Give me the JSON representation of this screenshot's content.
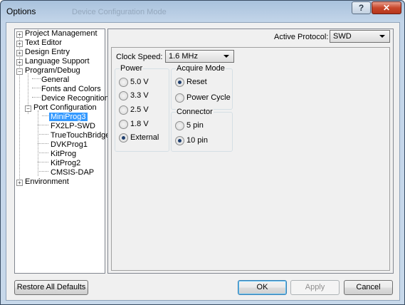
{
  "window": {
    "title": "Options",
    "ghost_title": "Device Configuration Mode"
  },
  "tree": {
    "items": [
      {
        "label": "Project Management"
      },
      {
        "label": "Text Editor"
      },
      {
        "label": "Design Entry"
      },
      {
        "label": "Language Support"
      },
      {
        "label": "Program/Debug"
      },
      {
        "label": "General"
      },
      {
        "label": "Fonts and Colors"
      },
      {
        "label": "Device Recognition"
      },
      {
        "label": "Port Configuration"
      },
      {
        "label": "MiniProg3"
      },
      {
        "label": "FX2LP-SWD"
      },
      {
        "label": "TrueTouchBridge"
      },
      {
        "label": "DVKProg1"
      },
      {
        "label": "KitProg"
      },
      {
        "label": "KitProg2"
      },
      {
        "label": "CMSIS-DAP"
      },
      {
        "label": "Environment"
      }
    ],
    "selected": "MiniProg3"
  },
  "panel": {
    "protocol_label": "Active Protocol:",
    "protocol_value": "SWD",
    "clock_label": "Clock Speed:",
    "clock_value": "1.6 MHz",
    "power": {
      "title": "Power",
      "options": [
        "5.0 V",
        "3.3 V",
        "2.5 V",
        "1.8 V",
        "External"
      ],
      "selected": "External"
    },
    "acquire": {
      "title": "Acquire Mode",
      "options": [
        "Reset",
        "Power Cycle"
      ],
      "selected": "Reset"
    },
    "connector": {
      "title": "Connector",
      "options": [
        "5 pin",
        "10 pin"
      ],
      "selected": "10 pin"
    }
  },
  "buttons": {
    "restore": "Restore All Defaults",
    "ok": "OK",
    "apply": "Apply",
    "cancel": "Cancel"
  }
}
